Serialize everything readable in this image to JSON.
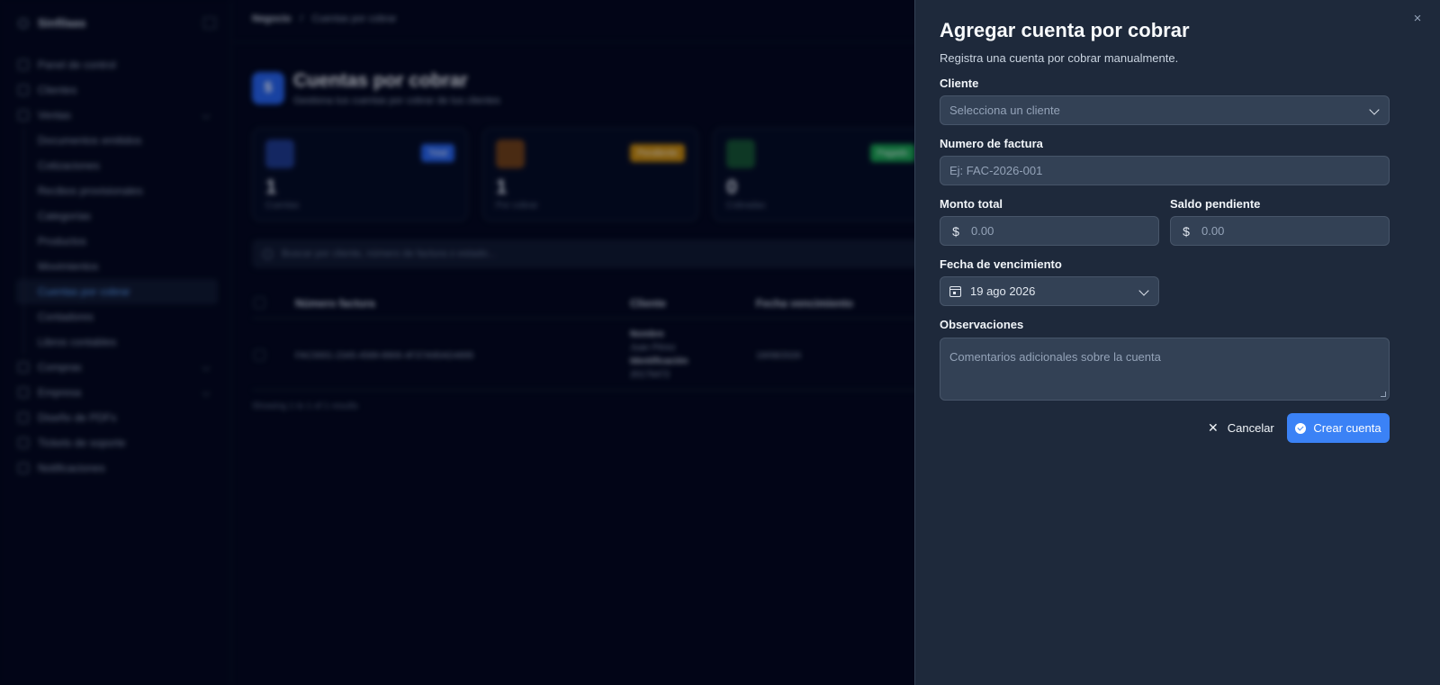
{
  "background": {
    "brand": "Sinfilaas",
    "nav": [
      {
        "label": "Panel de control"
      },
      {
        "label": "Clientes"
      },
      {
        "label": "Ventas",
        "expandable": true
      },
      {
        "label": "Documentos emitidos",
        "sub": true
      },
      {
        "label": "Cotizaciones",
        "sub": true
      },
      {
        "label": "Recibos provisionales",
        "sub": true
      },
      {
        "label": "Categorías",
        "sub": true
      },
      {
        "label": "Productos",
        "sub": true
      },
      {
        "label": "Movimientos",
        "sub": true
      },
      {
        "label": "Cuentas por cobrar",
        "sub": true,
        "active": true
      },
      {
        "label": "Contadores",
        "sub": true
      },
      {
        "label": "Libros contables",
        "sub": true
      },
      {
        "label": "Compras",
        "expandable": true
      },
      {
        "label": "Empresa",
        "expandable": true
      },
      {
        "label": "Diseño de PDFs"
      },
      {
        "label": "Tickets de soporte"
      },
      {
        "label": "Notificaciones"
      }
    ],
    "breadcrumb": {
      "first": "Negocio",
      "separator": "/",
      "current": "Cuentas por cobrar"
    },
    "page": {
      "icon_text": "$",
      "title": "Cuentas por cobrar",
      "subtitle": "Gestiona tus cuentas por cobrar de tus clientes"
    },
    "stats": [
      {
        "value": "1",
        "label": "Cuentas",
        "badge": "Total",
        "color": "#2563eb"
      },
      {
        "value": "1",
        "label": "Por cobrar",
        "badge": "Pendiente",
        "color": "#eab308"
      },
      {
        "value": "0",
        "label": "Cobradas",
        "badge": "Pagado",
        "color": "#16a34a"
      }
    ],
    "search_placeholder": "Buscar por cliente, número de factura o estado...",
    "table": {
      "headers": [
        "Número factura",
        "Cliente",
        "Fecha vencimiento"
      ],
      "rows": [
        {
          "invoice": "FAC0001-2345-4589-8906-4F37A95AD4895",
          "client_lines": [
            "Nombre",
            "Juan Pérez",
            "Identificación",
            "20176472"
          ],
          "due": "19/08/2026"
        }
      ]
    },
    "results_text": "Showing 1 to 1 of 1 results"
  },
  "drawer": {
    "title": "Agregar cuenta por cobrar",
    "subtitle": "Registra una cuenta por cobrar manualmente.",
    "cliente": {
      "label": "Cliente",
      "placeholder": "Selecciona un cliente"
    },
    "factura": {
      "label": "Numero de factura",
      "placeholder": "Ej: FAC-2026-001"
    },
    "monto": {
      "label": "Monto total",
      "placeholder": "0.00",
      "icon": "$"
    },
    "saldo": {
      "label": "Saldo pendiente",
      "placeholder": "0.00",
      "icon": "$"
    },
    "fecha": {
      "label": "Fecha de vencimiento",
      "value": "19 ago 2026"
    },
    "observaciones": {
      "label": "Observaciones",
      "placeholder": "Comentarios adicionales sobre la cuenta"
    },
    "cancel_label": "Cancelar",
    "create_label": "Crear cuenta",
    "close_icon": "×",
    "cancel_icon": "✕"
  }
}
